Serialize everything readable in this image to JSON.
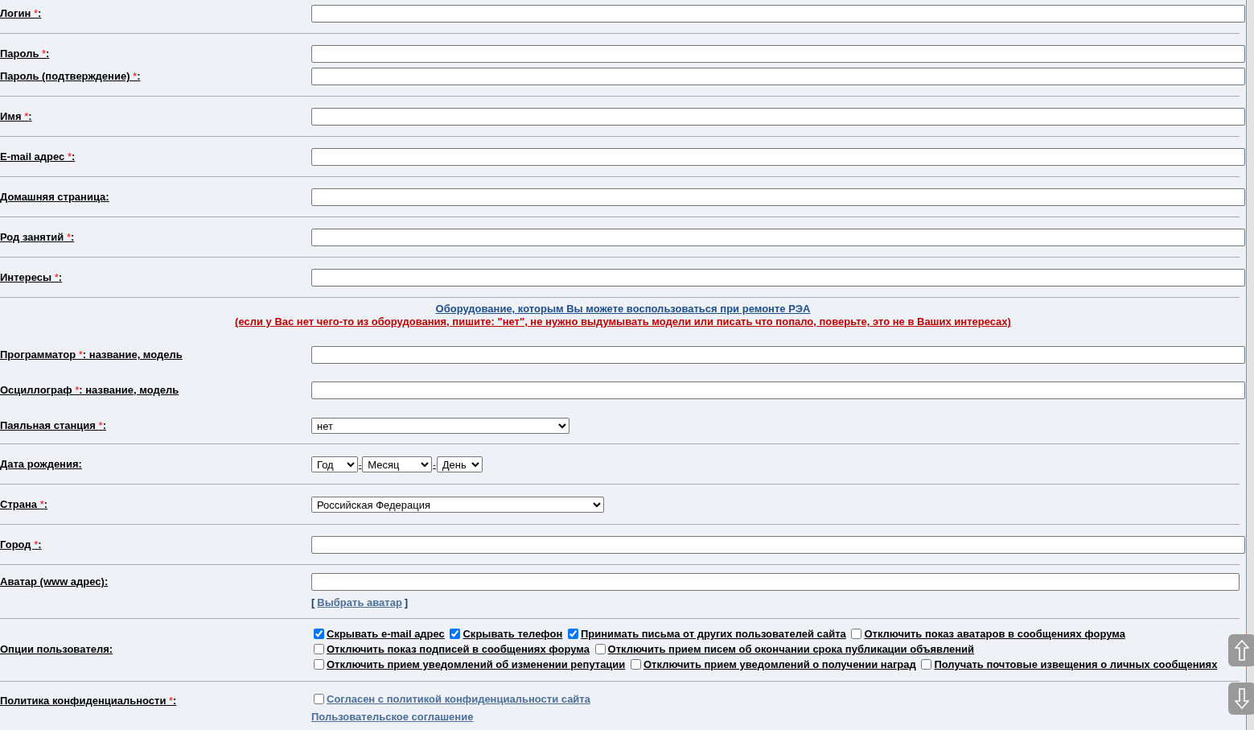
{
  "required_mark": "*",
  "groups": [
    {
      "rows": [
        {
          "kind": "text",
          "label": {
            "text": "Логин",
            "required": true,
            "suffix": ":"
          }
        }
      ]
    },
    {
      "rows": [
        {
          "kind": "text",
          "label": {
            "text": "Пароль",
            "required": true,
            "suffix": ":"
          }
        },
        {
          "kind": "text",
          "label": {
            "text": "Пароль (подтверждение)",
            "required": true,
            "suffix": ":"
          }
        }
      ]
    },
    {
      "rows": [
        {
          "kind": "text",
          "label": {
            "text": "Имя",
            "required": true,
            "suffix": ":"
          }
        }
      ]
    },
    {
      "rows": [
        {
          "kind": "text",
          "label": {
            "text": "E-mail адрес",
            "required": true,
            "suffix": ":"
          }
        }
      ]
    },
    {
      "rows": [
        {
          "kind": "text",
          "label": {
            "text": "Домашняя страница:",
            "required": false
          }
        }
      ]
    },
    {
      "rows": [
        {
          "kind": "text",
          "label": {
            "text": "Род занятий",
            "required": true,
            "suffix": ":"
          }
        }
      ]
    },
    {
      "rows": [
        {
          "kind": "text",
          "label": {
            "text": "Интересы",
            "required": true,
            "suffix": ":"
          }
        }
      ]
    },
    {
      "notice": {
        "title": "Оборудование, которым Вы можете воспользоваться при ремонте РЭА",
        "warning": "(если у Вас нет чего-то из оборудования, пишите: \"нет\", не нужно выдумывать модели или писать что попало, поверьте, это не в Ваших интересах)"
      },
      "rows": [
        {
          "kind": "text",
          "label": {
            "text": "Программатор",
            "required": true,
            "suffix": ": название, модель"
          }
        },
        {
          "kind": "text",
          "label": {
            "text": "Осциллограф",
            "required": true,
            "suffix": ": название, модель"
          }
        },
        {
          "kind": "select",
          "label": {
            "text": "Паяльная станция",
            "required": true,
            "suffix": ":"
          },
          "value": "нет"
        }
      ]
    },
    {
      "rows": [
        {
          "kind": "date",
          "label": {
            "text": "Дата рождения:",
            "required": false
          },
          "separator": "-",
          "selects": [
            {
              "value": "Год"
            },
            {
              "value": "Месяц"
            },
            {
              "value": "День"
            }
          ]
        }
      ]
    },
    {
      "rows": [
        {
          "kind": "select",
          "label": {
            "text": "Страна",
            "required": true,
            "suffix": ":"
          },
          "value": "Российская Федерация"
        }
      ]
    },
    {
      "rows": [
        {
          "kind": "text",
          "label": {
            "text": "Город",
            "required": true,
            "suffix": ":"
          }
        }
      ]
    },
    {
      "rows": [
        {
          "kind": "avatar",
          "label": {
            "text": "Аватар (www адрес):",
            "required": false
          },
          "open": "[",
          "link": "Выбрать аватар",
          "close": "]"
        }
      ]
    },
    {
      "rows": [
        {
          "kind": "options",
          "label": {
            "text": "Опции пользователя:",
            "required": false
          },
          "options": [
            {
              "label": "Скрывать e-mail адрес",
              "checked": true
            },
            {
              "label": "Скрывать телефон",
              "checked": true
            },
            {
              "label": "Принимать письма от других пользователей сайта",
              "checked": true
            },
            {
              "label": "Отключить показ аватаров в сообщениях форума",
              "checked": false
            },
            {
              "label": "Отключить показ подписей в сообщениях форума",
              "checked": false
            },
            {
              "label": "Отключить прием писем об окончании срока публикации объявлений",
              "checked": false
            },
            {
              "label": "Отключить прием уведомлений об изменении репутации",
              "checked": false
            },
            {
              "label": "Отключить прием уведомлений о получении наград",
              "checked": false
            },
            {
              "label": "Получать почтовые извещения о личных сообщениях",
              "checked": false
            }
          ]
        }
      ]
    },
    {
      "rows": [
        {
          "kind": "agreement",
          "label": {
            "text": "Политика конфиденциальности",
            "required": true,
            "suffix": ":"
          },
          "checkbox": {
            "label": "Согласен с политикой конфиденциальности сайта",
            "checked": false
          },
          "link": "Пользовательское соглашение"
        }
      ]
    }
  ]
}
